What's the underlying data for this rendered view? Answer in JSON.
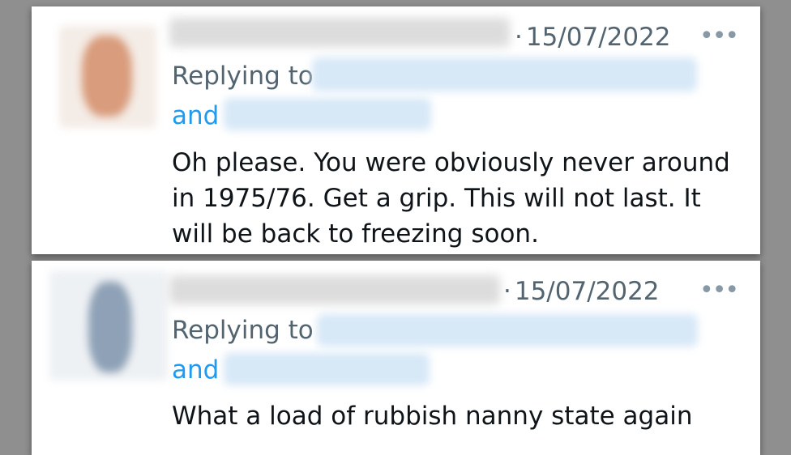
{
  "tweets": [
    {
      "date": "15/07/2022",
      "replying_to": "Replying to",
      "and": "and",
      "text": "Oh please. You were obviously never around in 1975/76. Get a grip. This will not last. It will be back to freezing soon."
    },
    {
      "date": "15/07/2022",
      "replying_to": "Replying to",
      "and": "and",
      "text": "What a load of rubbish nanny state again"
    }
  ],
  "icons": {
    "more": "more-options-icon"
  },
  "colors": {
    "mention": "#1d9bf0",
    "secondary": "#536471",
    "text": "#0f1419"
  }
}
